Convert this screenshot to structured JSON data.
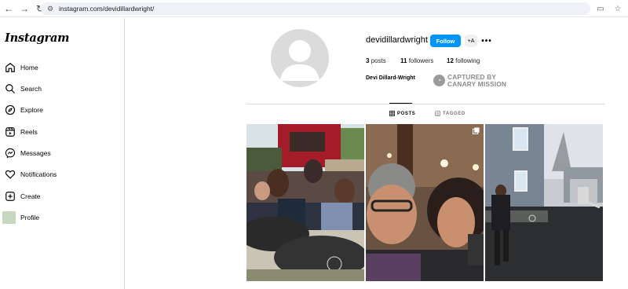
{
  "browser": {
    "url": "instagram.com/devidillardwright/"
  },
  "sidebar": {
    "logo": "Instagram",
    "items": [
      {
        "label": "Home",
        "icon": "home-icon"
      },
      {
        "label": "Search",
        "icon": "search-icon"
      },
      {
        "label": "Explore",
        "icon": "compass-icon"
      },
      {
        "label": "Reels",
        "icon": "reels-icon"
      },
      {
        "label": "Messages",
        "icon": "messenger-icon"
      },
      {
        "label": "Notifications",
        "icon": "heart-icon"
      },
      {
        "label": "Create",
        "icon": "plus-square-icon"
      },
      {
        "label": "Profile",
        "icon": "avatar"
      }
    ]
  },
  "profile": {
    "username": "devidillardwright",
    "follow_label": "Follow",
    "suggest_label": "+A",
    "more_label": "•••",
    "posts_count": "3",
    "posts_label": "posts",
    "followers_count": "11",
    "followers_label": "followers",
    "following_count": "12",
    "following_label": "following",
    "full_name": "Devi Dillard-Wright",
    "stamp_line1": "CAPTURED BY",
    "stamp_line2": "CANARY MISSION"
  },
  "tabs": [
    {
      "label": "POSTS",
      "active": true
    },
    {
      "label": "TAGGED",
      "active": false
    }
  ],
  "colors": {
    "accent": "#0095f6",
    "avatar_bg": "#dbdbdb",
    "profile_thumb": "#c6d7bf"
  }
}
